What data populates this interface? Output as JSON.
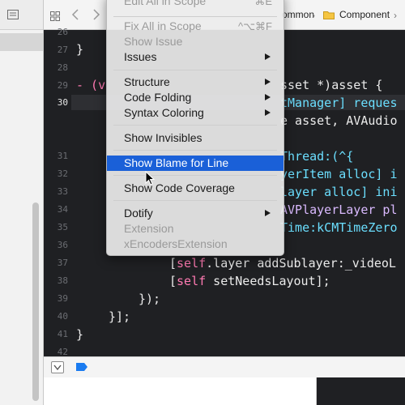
{
  "jumpbar": {
    "crumbs": [
      "ommon",
      "Component"
    ]
  },
  "editor": {
    "line_numbers": [
      "26",
      "27",
      "28",
      "29",
      "30",
      "",
      "",
      "31",
      "32",
      "33",
      "34",
      "35",
      "36",
      "37",
      "38",
      "39",
      "40",
      "41",
      "42"
    ],
    "current_line": "30",
    "lines": {
      "l27": "}",
      "l29_prefix": "- (v",
      "l29_suffix": "sset *)asset {",
      "l30": "tManager] reques",
      "l30b": "e asset, AVAudio",
      "l31": "Thread:(^{",
      "l32": "yerItem alloc] i",
      "l33": "layer alloc] ini",
      "l34": "AVPlayerLayer pl",
      "l35": "Time:kCMTimeZero",
      "l37_open": "[",
      "l37_kw": "self",
      "l37_rest": ".layer addSublayer:_videoL",
      "l38_open": "[",
      "l38_kw": "self",
      "l38_rest": " setNeedsLayout];",
      "l39": "});",
      "l40": "}];",
      "l41": "}"
    }
  },
  "menu": {
    "items": [
      {
        "label": "Edit All in Scope",
        "shortcut": "⌘E",
        "state": "disabled"
      },
      {
        "label": "Fix All in Scope",
        "shortcut": "^⌥⌘F",
        "state": "disabled"
      },
      {
        "label": "Show Issue",
        "state": "disabled"
      },
      {
        "label": "Issues",
        "submenu": true
      },
      {
        "label": "Structure",
        "submenu": true
      },
      {
        "label": "Code Folding",
        "submenu": true
      },
      {
        "label": "Syntax Coloring",
        "submenu": true
      },
      {
        "label": "Show Invisibles"
      },
      {
        "label": "Show Blame for Line",
        "state": "selected"
      },
      {
        "label": "Show Code Coverage"
      },
      {
        "label": "Dotify",
        "submenu": true
      },
      {
        "label": "Extension",
        "state": "disabled"
      },
      {
        "label": "xEncodersExtension",
        "state": "disabled"
      }
    ]
  },
  "colors": {
    "editor_bg": "#1f2023",
    "keyword": "#ff7ab2",
    "menu_highlight": "#1a60d8"
  },
  "icons": [
    "list-icon",
    "grid-icon",
    "back-arrow-icon",
    "forward-arrow-icon",
    "folder-icon",
    "hide-debug-icon",
    "breakpoint-icon",
    "mouse-cursor-icon"
  ]
}
